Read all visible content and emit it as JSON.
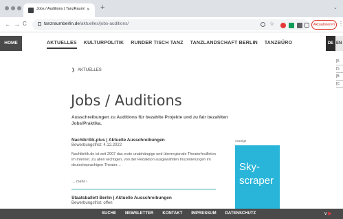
{
  "browser": {
    "tab_title": "Jobs / Auditions | TanzRaumB...",
    "tab_close": "×",
    "new_tab": "+",
    "tab_menu": "⌄",
    "url_domain": "tanzraumberlin.de",
    "url_path": "/aktuelles/jobs-auditions/",
    "update_button": "Aktualisieren",
    "back": "←",
    "forward": "→",
    "reload": "C",
    "menu": "⋮",
    "extension_colors": [
      "#5f6368",
      "#5f6368",
      "#e53935",
      "#0f9d58",
      "#5f6368",
      "#5f6368"
    ]
  },
  "site": {
    "home": "HOME",
    "nav": [
      "AKTUELLES",
      "KULTURPOLITIK",
      "RUNDER TISCH TANZ",
      "TANZLANDSCHAFT BERLIN",
      "TANZBÜRO"
    ],
    "active_nav": "AKTUELLES",
    "lang_de": "DE",
    "lang_en": "EN",
    "side_menu": [
      "[K",
      "[S",
      "[B",
      "[C"
    ]
  },
  "main": {
    "breadcrumb_chevron": "❯",
    "breadcrumb": "AKTUELLES",
    "title": "Jobs / Auditions",
    "subtitle": "Ausschreibungen zu Auditions für bezahlte Projekte und zu fair bezahlten Jobs/Praktika.",
    "entries": [
      {
        "title": "Nachtkritik.plus | Aktuelle Ausschreibungen",
        "deadline": "Bewerbungsfrist: 4.12.2022",
        "text": "Nachtkritik.de ist seit 2007 das erste unabhängige und überregionale Theaterfeuilleton im Internet. Zu allen wichtigen, von der Redaktion ausgewählten Inszenierungen im deutschsprachigen Theater…",
        "more": "… mehr ›"
      },
      {
        "title": "Staatsballett Berlin | Aktuelle Ausschreibungen",
        "deadline": "Bewerbungsfrist: offen"
      }
    ]
  },
  "ad": {
    "label": "Anzeige",
    "text": "Sky-scraper",
    "color": "#29b5d9"
  },
  "footer": {
    "links": [
      "SUCHE",
      "NEWSLETTER",
      "KONTAKT",
      "IMPRESSUM",
      "DATENSCHUTZ"
    ]
  }
}
